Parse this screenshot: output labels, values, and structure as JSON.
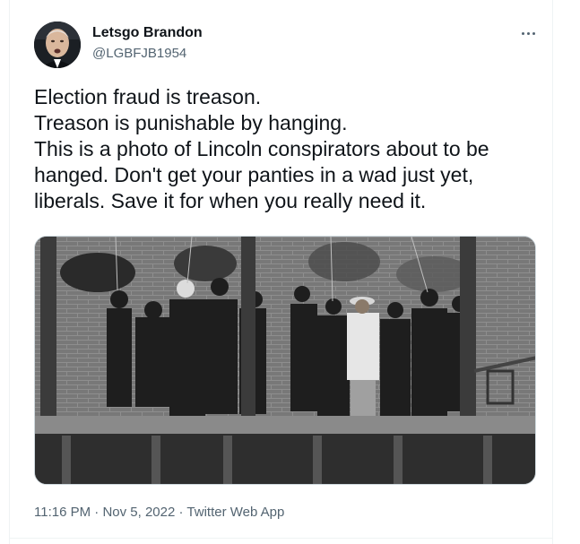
{
  "tweet": {
    "author": {
      "display_name": "Letsgo Brandon",
      "handle": "@LGBFJB1954",
      "avatar_icon": "profile-photo"
    },
    "more_icon": "ellipsis-icon",
    "text_lines": [
      "Election fraud is treason.",
      "Treason is punishable by hanging.",
      "This is a photo of Lincoln conspirators about to be",
      "hanged. Don't get your panties in a wad just yet,",
      "liberals. Save it for when you really need it."
    ],
    "media": {
      "type": "photo",
      "description_icon": "black-and-white-historical-photo"
    },
    "time": "11:16 PM",
    "separator": "·",
    "date": "Nov 5, 2022",
    "source": "Twitter Web App"
  },
  "colors": {
    "text_primary": "#0f1419",
    "text_secondary": "#536471",
    "border": "#eff3f4"
  }
}
